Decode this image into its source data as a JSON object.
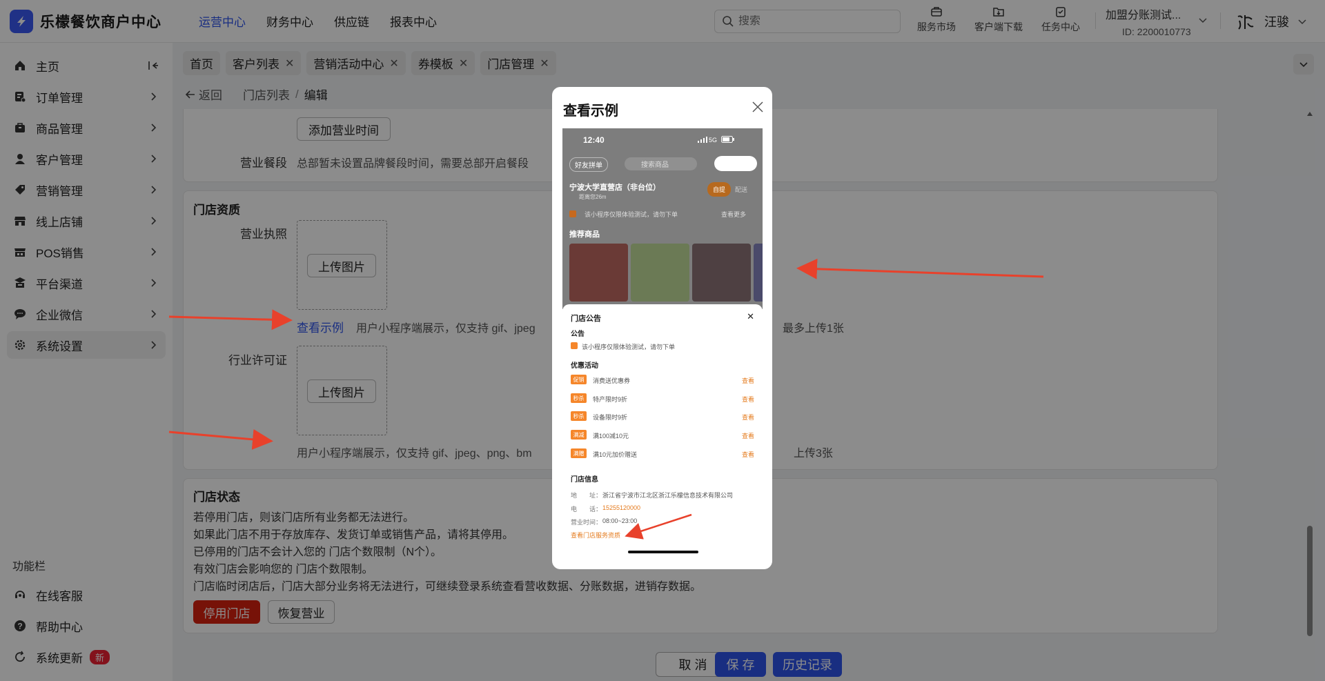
{
  "app": {
    "title": "乐檬餐饮商户中心"
  },
  "topnav": [
    "运营中心",
    "财务中心",
    "供应链",
    "报表中心"
  ],
  "search": {
    "placeholder": "搜索"
  },
  "tools": [
    "服务市场",
    "客户端下载",
    "任务中心"
  ],
  "account": {
    "name": "加盟分账测试...",
    "id": "ID: 2200010773"
  },
  "user": {
    "name": "汪骏"
  },
  "sidebar": {
    "items": [
      {
        "label": "主页",
        "icon": "home-icon"
      },
      {
        "label": "订单管理",
        "icon": "order-icon"
      },
      {
        "label": "商品管理",
        "icon": "goods-icon"
      },
      {
        "label": "客户管理",
        "icon": "customer-icon"
      },
      {
        "label": "营销管理",
        "icon": "tag-icon"
      },
      {
        "label": "线上店铺",
        "icon": "store-icon"
      },
      {
        "label": "POS销售",
        "icon": "pos-icon"
      },
      {
        "label": "平台渠道",
        "icon": "channel-icon"
      },
      {
        "label": "企业微信",
        "icon": "chat-icon"
      },
      {
        "label": "系统设置",
        "icon": "gear-icon"
      }
    ],
    "func_title": "功能栏",
    "func_items": [
      {
        "label": "在线客服"
      },
      {
        "label": "帮助中心"
      },
      {
        "label": "系统更新",
        "badge": "新"
      }
    ]
  },
  "tabs": [
    "首页",
    "客户列表",
    "营销活动中心",
    "券模板",
    "门店管理"
  ],
  "breadcrumb": {
    "back": "返回",
    "list": "门店列表",
    "sep": "/",
    "current": "编辑"
  },
  "hours": {
    "add_button": "添加营业时间",
    "meal_label": "营业餐段",
    "meal_text": "总部暂未设置品牌餐段时间，需要总部开启餐段"
  },
  "qual": {
    "title": "门店资质",
    "license_label": "营业执照",
    "upload": "上传图片",
    "example_link": "查看示例",
    "license_hint_a": "用户小程序端展示，仅支持 gif、jpeg",
    "license_hint_b": "最多上传1张",
    "permit_label": "行业许可证",
    "permit_hint_a": "用户小程序端展示，仅支持 gif、jpeg、png、bm",
    "permit_hint_b": "上传3张"
  },
  "status": {
    "title": "门店状态",
    "lines": [
      "若停用门店，则该门店所有业务都无法进行。",
      "如果此门店不用于存放库存、发货订单或销售产品，请将其停用。",
      "已停用的门店不会计入您的 门店个数限制（N个）。",
      "有效门店会影响您的 门店个数限制。",
      "门店临时闭店后，门店大部分业务将无法进行，可继续登录系统查看营收数据、分账数据，进销存数据。"
    ],
    "disable_button": "停用门店",
    "resume_button": "恢复营业"
  },
  "footer": {
    "cancel": "取 消",
    "save": "保 存",
    "history": "历史记录"
  },
  "modal": {
    "title": "查看示例",
    "phone": {
      "time": "12:40",
      "signal": "5G",
      "group_btn": "好友拼单",
      "search": "搜索商品",
      "store_name": "宁波大学直营店（非台位）",
      "distance": "距离您26m",
      "self_pick": "自提",
      "delivery": "配送",
      "notice_bar": "该小程序仅限体验测试，请勿下单",
      "view_more": "查看更多",
      "recommend": "推荐商品",
      "sheet_title": "门店公告",
      "notice_title": "公告",
      "notice_text": "该小程序仅限体验测试，请勿下单",
      "promo_title": "优惠活动",
      "promos": [
        {
          "tag": "促销",
          "text": "消费送优惠券",
          "link": "查看"
        },
        {
          "tag": "秒杀",
          "text": "特产限时9折",
          "link": "查看"
        },
        {
          "tag": "秒杀",
          "text": "设备限时9折",
          "link": "查看"
        },
        {
          "tag": "满减",
          "text": "满100减10元",
          "link": "查看"
        },
        {
          "tag": "满赠",
          "text": "满10元加价赠送",
          "link": "查看"
        }
      ],
      "info_title": "门店信息",
      "address_label": "地　　址：",
      "address": "浙江省宁波市江北区浙江乐檬信息技术有限公司",
      "phone_label": "电　　话：",
      "phone_number": "15255120000",
      "hours_label": "营业时间：",
      "hours": "08:00~23:00",
      "service_link": "查看门店服务资质"
    }
  },
  "colors": {
    "accent": "#2f54eb",
    "danger": "#d9210f",
    "orange": "#f5862a",
    "arrow": "#e8412b"
  }
}
